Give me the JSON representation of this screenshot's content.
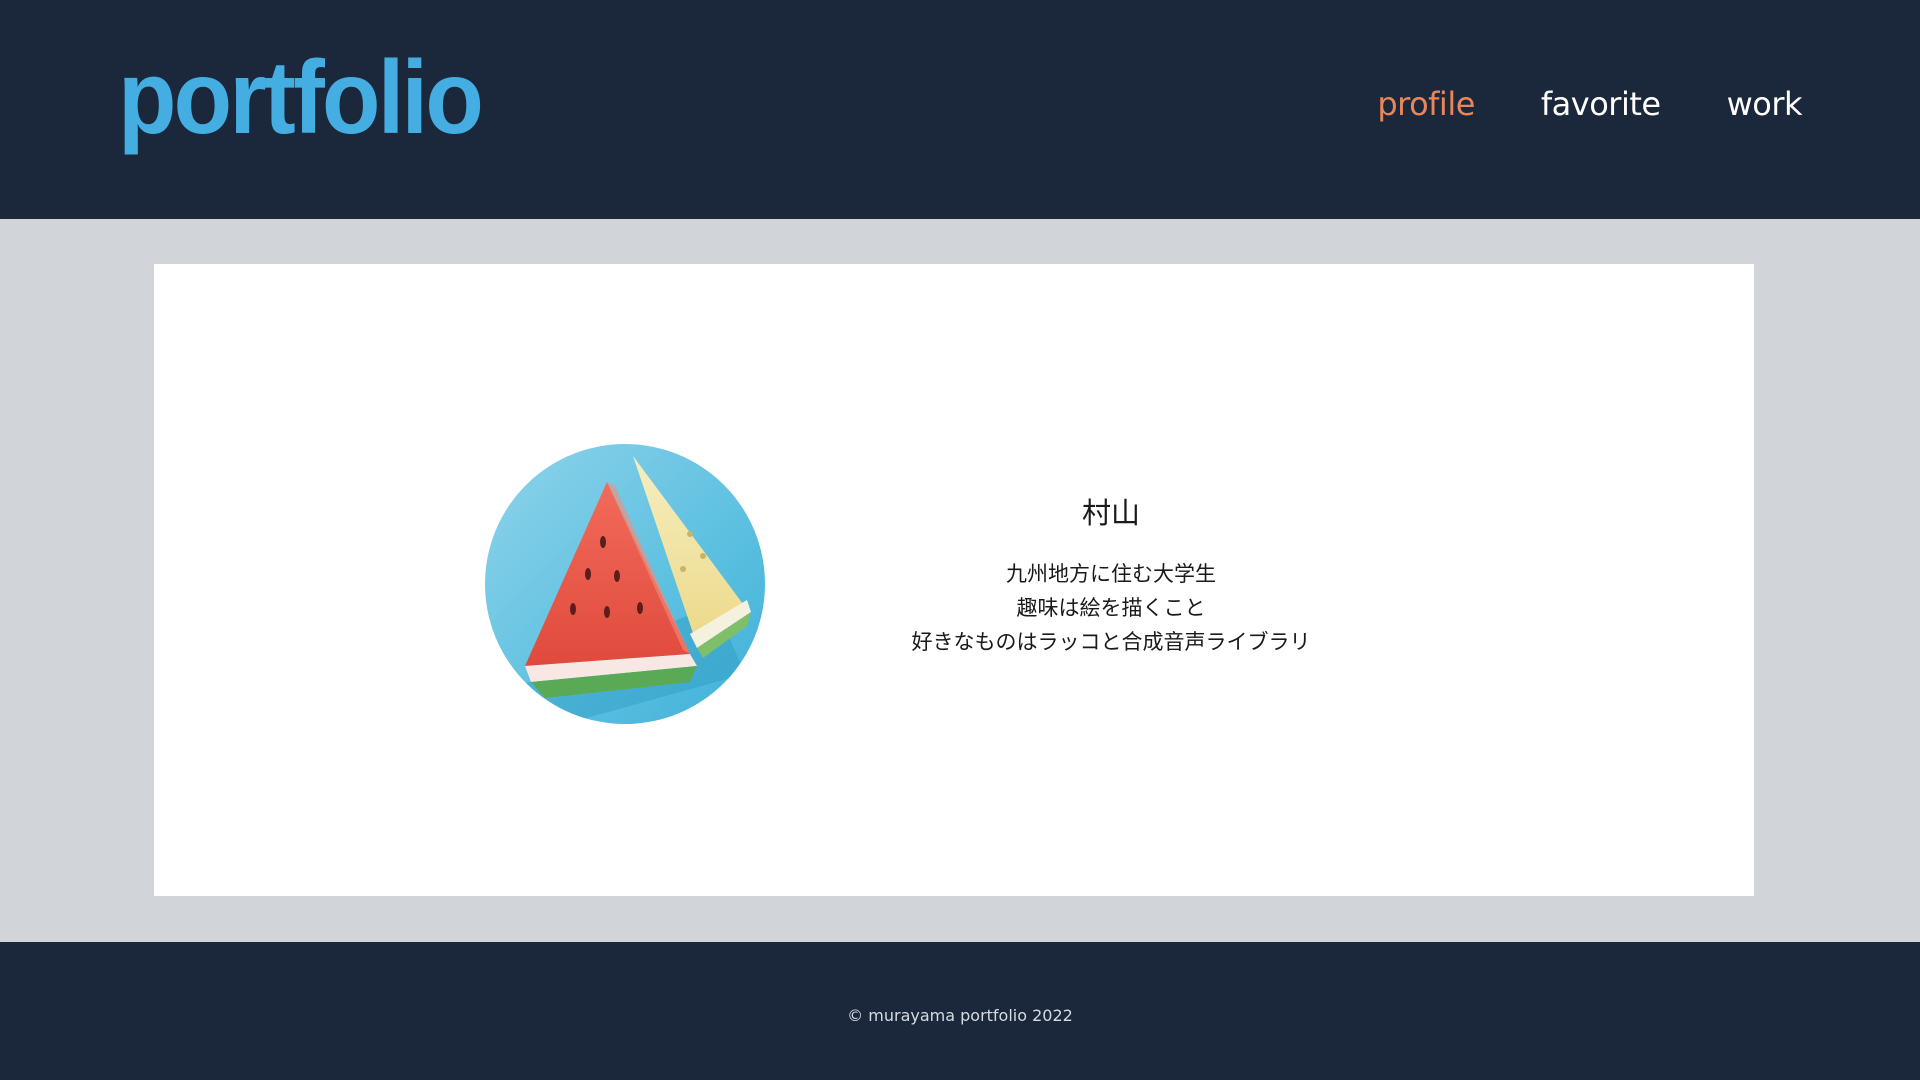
{
  "header": {
    "logo": "portfolio",
    "nav": [
      {
        "label": "profile",
        "active": true
      },
      {
        "label": "favorite",
        "active": false
      },
      {
        "label": "work",
        "active": false
      }
    ]
  },
  "profile": {
    "avatar_icon": "watermelon-slices-image",
    "name": "村山",
    "lines": [
      "九州地方に住む大学生",
      "趣味は絵を描くこと",
      "好きなものはラッコと合成音声ライブラリ"
    ]
  },
  "footer": {
    "copyright": "© murayama portfolio 2022"
  },
  "colors": {
    "header_bg": "#1b283c",
    "page_bg": "#d1d5da",
    "logo": "#44ade1",
    "nav_active": "#e8865a",
    "nav_inactive": "#ffffff"
  }
}
